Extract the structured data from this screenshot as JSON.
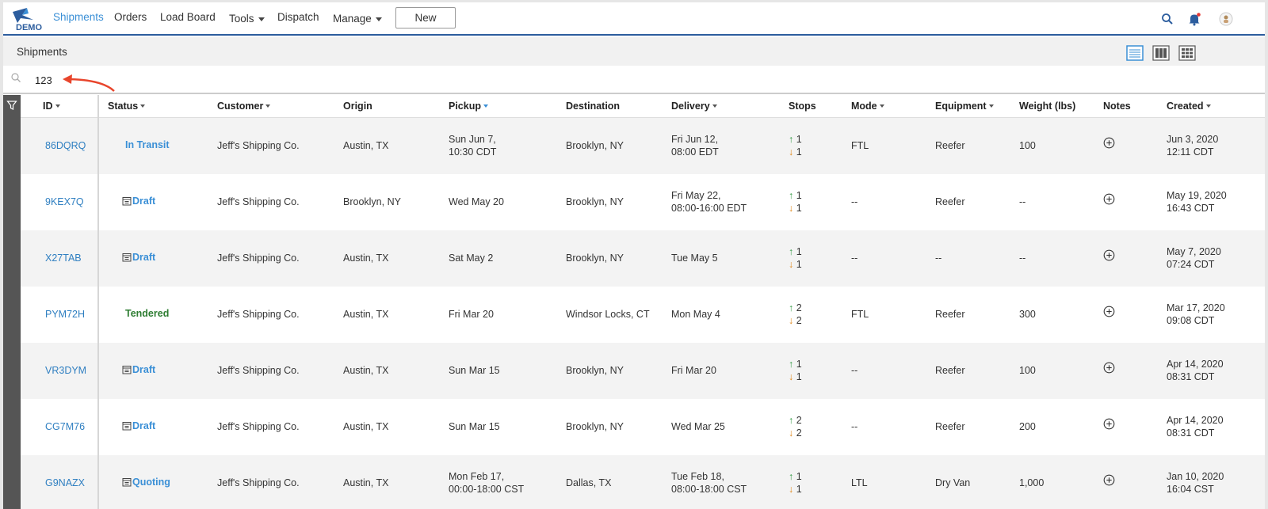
{
  "nav": {
    "logo_text": "DEMO",
    "items": [
      {
        "label": "Shipments",
        "active": true
      },
      {
        "label": "Orders"
      },
      {
        "label": "Load Board"
      },
      {
        "label": "Tools",
        "dropdown": true
      },
      {
        "label": "Dispatch"
      },
      {
        "label": "Manage",
        "dropdown": true
      }
    ],
    "new_button": "New"
  },
  "subheader": {
    "title": "Shipments"
  },
  "search": {
    "value": "123"
  },
  "colors": {
    "accent": "#3a8fd6",
    "nav_border": "#2c5d9e",
    "tendered": "#2e7d32",
    "up_arrow": "#3a9d4a",
    "down_arrow": "#e08a1e"
  },
  "table": {
    "headers": {
      "id": "ID",
      "status": "Status",
      "customer": "Customer",
      "origin": "Origin",
      "pickup": "Pickup",
      "destination": "Destination",
      "delivery": "Delivery",
      "stops": "Stops",
      "mode": "Mode",
      "equipment": "Equipment",
      "weight": "Weight (lbs)",
      "notes": "Notes",
      "created": "Created"
    },
    "rows": [
      {
        "id": "86DQRQ",
        "status": "In Transit",
        "customer": "Jeff's Shipping Co.",
        "origin": "Austin, TX",
        "pickup1": "Sun Jun 7,",
        "pickup2": "10:30 CDT",
        "destination": "Brooklyn, NY",
        "delivery1": "Fri Jun 12,",
        "delivery2": "08:00 EDT",
        "stops_up": "1",
        "stops_down": "1",
        "mode": "FTL",
        "equipment": "Reefer",
        "weight": "100",
        "created1": "Jun 3, 2020",
        "created2": "12:11 CDT"
      },
      {
        "id": "9KEX7Q",
        "status": "Draft",
        "customer": "Jeff's Shipping Co.",
        "origin": "Brooklyn, NY",
        "pickup1": "Wed May 20",
        "pickup2": "",
        "destination": "Brooklyn, NY",
        "delivery1": "Fri May 22,",
        "delivery2": "08:00-16:00 EDT",
        "stops_up": "1",
        "stops_down": "1",
        "mode": "--",
        "equipment": "Reefer",
        "weight": "--",
        "created1": "May 19, 2020",
        "created2": "16:43 CDT"
      },
      {
        "id": "X27TAB",
        "status": "Draft",
        "customer": "Jeff's Shipping Co.",
        "origin": "Austin, TX",
        "pickup1": "Sat May 2",
        "pickup2": "",
        "destination": "Brooklyn, NY",
        "delivery1": "Tue May 5",
        "delivery2": "",
        "stops_up": "1",
        "stops_down": "1",
        "mode": "--",
        "equipment": "--",
        "weight": "--",
        "created1": "May 7, 2020",
        "created2": "07:24 CDT"
      },
      {
        "id": "PYM72H",
        "status": "Tendered",
        "customer": "Jeff's Shipping Co.",
        "origin": "Austin, TX",
        "pickup1": "Fri Mar 20",
        "pickup2": "",
        "destination": "Windsor Locks, CT",
        "delivery1": "Mon May 4",
        "delivery2": "",
        "stops_up": "2",
        "stops_down": "2",
        "mode": "FTL",
        "equipment": "Reefer",
        "weight": "300",
        "created1": "Mar 17, 2020",
        "created2": "09:08 CDT"
      },
      {
        "id": "VR3DYM",
        "status": "Draft",
        "customer": "Jeff's Shipping Co.",
        "origin": "Austin, TX",
        "pickup1": "Sun Mar 15",
        "pickup2": "",
        "destination": "Brooklyn, NY",
        "delivery1": "Fri Mar 20",
        "delivery2": "",
        "stops_up": "1",
        "stops_down": "1",
        "mode": "--",
        "equipment": "Reefer",
        "weight": "100",
        "created1": "Apr 14, 2020",
        "created2": "08:31 CDT"
      },
      {
        "id": "CG7M76",
        "status": "Draft",
        "customer": "Jeff's Shipping Co.",
        "origin": "Austin, TX",
        "pickup1": "Sun Mar 15",
        "pickup2": "",
        "destination": "Brooklyn, NY",
        "delivery1": "Wed Mar 25",
        "delivery2": "",
        "stops_up": "2",
        "stops_down": "2",
        "mode": "--",
        "equipment": "Reefer",
        "weight": "200",
        "created1": "Apr 14, 2020",
        "created2": "08:31 CDT"
      },
      {
        "id": "G9NAZX",
        "status": "Quoting",
        "customer": "Jeff's Shipping Co.",
        "origin": "Austin, TX",
        "pickup1": "Mon Feb 17,",
        "pickup2": "00:00-18:00 CST",
        "destination": "Dallas, TX",
        "delivery1": "Tue Feb 18,",
        "delivery2": "08:00-18:00 CST",
        "stops_up": "1",
        "stops_down": "1",
        "mode": "LTL",
        "equipment": "Dry Van",
        "weight": "1,000",
        "created1": "Jan 10, 2020",
        "created2": "16:04 CST"
      }
    ]
  }
}
